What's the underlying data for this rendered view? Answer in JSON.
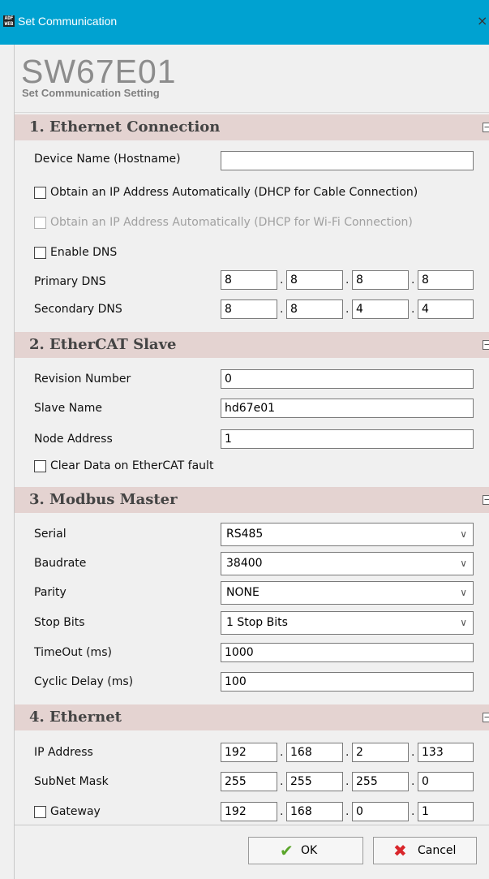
{
  "window": {
    "title": "Set Communication",
    "close_glyph": "×",
    "app_icon_text": "ADF WEB"
  },
  "header": {
    "title": "SW67E01",
    "subtitle": "Set Communication Setting"
  },
  "sections": {
    "ethernet_connection": {
      "title": "1. Ethernet Connection",
      "collapse": "−"
    },
    "ethercat_slave": {
      "title": "2. EtherCAT Slave",
      "collapse": "−"
    },
    "modbus_master": {
      "title": "3. Modbus Master",
      "collapse": "−"
    },
    "ethernet": {
      "title": "4. Ethernet",
      "collapse": "−"
    }
  },
  "eth_conn": {
    "device_name_label": "Device Name (Hostname)",
    "device_name_value": "",
    "dhcp_cable_label": "Obtain an IP Address Automatically (DHCP for Cable Connection)",
    "dhcp_wifi_label": "Obtain an IP Address Automatically (DHCP for Wi-Fi Connection)",
    "enable_dns_label": "Enable DNS",
    "primary_dns_label": "Primary DNS",
    "primary_dns": [
      "8",
      "8",
      "8",
      "8"
    ],
    "secondary_dns_label": "Secondary DNS",
    "secondary_dns": [
      "8",
      "8",
      "4",
      "4"
    ]
  },
  "ethercat": {
    "revision_label": "Revision Number",
    "revision_value": "0",
    "slave_name_label": "Slave Name",
    "slave_name_value": "hd67e01",
    "node_address_label": "Node Address",
    "node_address_value": "1",
    "clear_data_label": "Clear Data on EtherCAT fault"
  },
  "modbus": {
    "serial_label": "Serial",
    "serial_value": "RS485",
    "baudrate_label": "Baudrate",
    "baudrate_value": "38400",
    "parity_label": "Parity",
    "parity_value": "NONE",
    "stop_bits_label": "Stop Bits",
    "stop_bits_value": "1 Stop Bits",
    "timeout_label": "TimeOut (ms)",
    "timeout_value": "1000",
    "cyclic_delay_label": "Cyclic Delay (ms)",
    "cyclic_delay_value": "100",
    "chevron": "∨"
  },
  "ethernet": {
    "ip_label": "IP Address",
    "ip": [
      "192",
      "168",
      "2",
      "133"
    ],
    "subnet_label": "SubNet Mask",
    "subnet": [
      "255",
      "255",
      "255",
      "0"
    ],
    "gateway_label": "Gateway",
    "gateway": [
      "192",
      "168",
      "0",
      "1"
    ]
  },
  "buttons": {
    "ok_label": "OK",
    "cancel_label": "Cancel",
    "ok_icon": "✔",
    "cancel_icon": "✖"
  },
  "colors": {
    "titlebar": "#00a2d1",
    "section_bg": "#e4d3d1",
    "ok_icon": "#5aa52a",
    "cancel_icon": "#d9262b"
  }
}
